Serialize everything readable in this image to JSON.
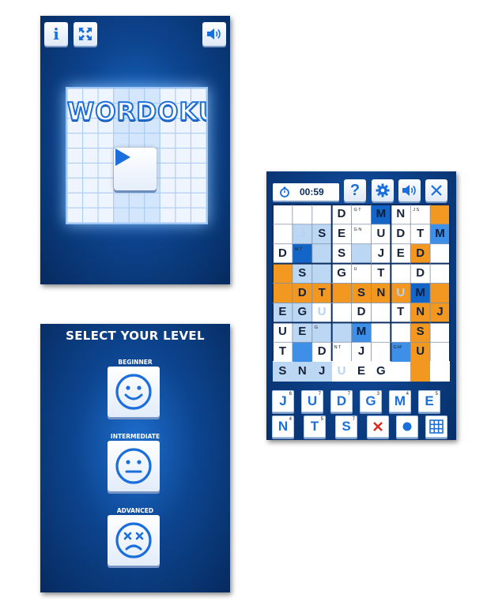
{
  "title_screen": {
    "logo_text": "WORDOKU",
    "info_label": "i"
  },
  "level_screen": {
    "title": "SELECT YOUR LEVEL",
    "levels": [
      {
        "label": "BEGINNER",
        "face": "smiley-face-icon"
      },
      {
        "label": "INTERMEDIATE",
        "face": "neutral-face-icon"
      },
      {
        "label": "ADVANCED",
        "face": "dizzy-face-icon"
      }
    ]
  },
  "game_screen": {
    "timer": "00:59",
    "help_label": "?",
    "grid": [
      [
        {
          "v": "",
          "c": "w"
        },
        {
          "v": "",
          "c": "w"
        },
        {
          "v": "",
          "c": "w"
        },
        {
          "v": "D",
          "c": "w"
        },
        {
          "v": "",
          "c": "w",
          "n": "G T"
        },
        {
          "v": "M",
          "c": "d"
        },
        {
          "v": "N",
          "c": "w"
        },
        {
          "v": "",
          "c": "w",
          "n": "J S"
        },
        {
          "v": "",
          "c": "o"
        }
      ],
      [
        {
          "v": "",
          "c": "w"
        },
        {
          "v": "J",
          "c": "l",
          "g": true
        },
        {
          "v": "S",
          "c": "l"
        },
        {
          "v": "E",
          "c": "w"
        },
        {
          "v": "",
          "c": "w",
          "n": "G N"
        },
        {
          "v": "U",
          "c": "w"
        },
        {
          "v": "D",
          "c": "w"
        },
        {
          "v": "T",
          "c": "w"
        },
        {
          "v": "M",
          "c": "m"
        }
      ],
      [
        {
          "v": "D",
          "c": "w"
        },
        {
          "v": "",
          "c": "d",
          "n": "M T"
        },
        {
          "v": "",
          "c": "l"
        },
        {
          "v": "S",
          "c": "w"
        },
        {
          "v": "",
          "c": "l"
        },
        {
          "v": "J",
          "c": "w"
        },
        {
          "v": "E",
          "c": "w"
        },
        {
          "v": "D",
          "c": "o"
        },
        {
          "v": "",
          "c": "w"
        }
      ],
      [
        {
          "v": "",
          "c": "o"
        },
        {
          "v": "S",
          "c": "l"
        },
        {
          "v": "",
          "c": "l"
        },
        {
          "v": "G",
          "c": "w"
        },
        {
          "v": "",
          "c": "w",
          "n": "U"
        },
        {
          "v": "T",
          "c": "w"
        },
        {
          "v": "",
          "c": "w"
        },
        {
          "v": "D",
          "c": "w"
        },
        {
          "v": "",
          "c": "w"
        }
      ],
      [
        {
          "v": "",
          "c": "o"
        },
        {
          "v": "D",
          "c": "o"
        },
        {
          "v": "T",
          "c": "o"
        },
        {
          "v": "",
          "c": "o"
        },
        {
          "v": "S",
          "c": "o"
        },
        {
          "v": "N",
          "c": "o"
        },
        {
          "v": "U",
          "c": "o",
          "g": true
        },
        {
          "v": "M",
          "c": "d"
        },
        {
          "v": "",
          "c": "o"
        }
      ],
      [
        {
          "v": "E",
          "c": "l"
        },
        {
          "v": "G",
          "c": "l"
        },
        {
          "v": "U",
          "c": "w",
          "g": true
        },
        {
          "v": "",
          "c": "w"
        },
        {
          "v": "D",
          "c": "w"
        },
        {
          "v": "",
          "c": "w"
        },
        {
          "v": "T",
          "c": "w"
        },
        {
          "v": "N",
          "c": "o"
        },
        {
          "v": "J",
          "c": "o"
        }
      ],
      [
        {
          "v": "U",
          "c": "w"
        },
        {
          "v": "E",
          "c": "l"
        },
        {
          "v": "",
          "c": "l",
          "n": "G"
        },
        {
          "v": "",
          "c": "l"
        },
        {
          "v": "M",
          "c": "m"
        },
        {
          "v": "",
          "c": "w"
        },
        {
          "v": "",
          "c": "w"
        },
        {
          "v": "S",
          "c": "o"
        },
        {
          "v": "",
          "c": "w"
        }
      ],
      [
        {
          "v": "T",
          "c": "w"
        },
        {
          "v": "",
          "c": "m"
        },
        {
          "v": "D",
          "c": "w"
        },
        {
          "v": "",
          "c": "w",
          "n": "N T"
        },
        {
          "v": "J",
          "c": "w"
        },
        {
          "v": "",
          "c": "w"
        },
        {
          "v": "",
          "c": "m",
          "n": "G M"
        },
        {
          "v": "U",
          "c": "o"
        },
        {
          "v": "",
          "c": "w"
        }
      ],
      [
        {
          "v": "S",
          "c": "l"
        },
        {
          "v": "N",
          "c": "l"
        },
        {
          "v": "J",
          "c": "l"
        },
        {
          "v": "U",
          "c": "w",
          "g": true
        },
        {
          "v": "E",
          "c": "w"
        },
        {
          "v": "G",
          "c": "w"
        },
        {
          "v": "",
          "c": "w"
        },
        {
          "v": "",
          "c": "o"
        },
        {
          "v": "",
          "c": "w"
        }
      ]
    ],
    "keys_row1": [
      {
        "letter": "J",
        "count": "6"
      },
      {
        "letter": "U",
        "count": "7"
      },
      {
        "letter": "D",
        "count": "7"
      },
      {
        "letter": "G",
        "count": "3"
      },
      {
        "letter": "M",
        "count": "4"
      },
      {
        "letter": "E",
        "count": "5"
      }
    ],
    "keys_row2": [
      {
        "letter": "N",
        "count": "4"
      },
      {
        "letter": "T",
        "count": "5"
      },
      {
        "letter": "S",
        "count": "7"
      }
    ]
  },
  "colors": {
    "panel_dark": "#062a5e",
    "panel_mid": "#1e6fd0",
    "accent_blue": "#1a6fdc",
    "orange": "#f2971f",
    "light_blue": "#bcd7f4",
    "mid_blue": "#3d8fe8",
    "dark_blue": "#1465c8"
  }
}
